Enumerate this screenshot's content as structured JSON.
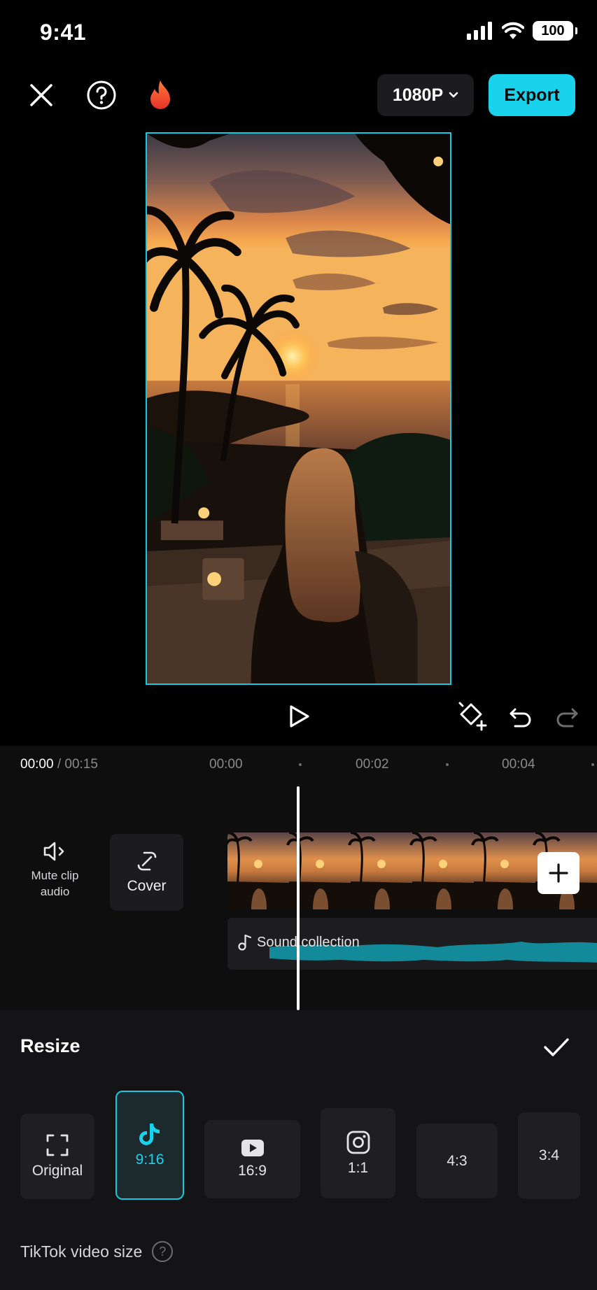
{
  "status_bar": {
    "time": "9:41",
    "battery": "100"
  },
  "toolbar": {
    "resolution": "1080P",
    "export_label": "Export"
  },
  "timeline": {
    "current_time": "00:00",
    "total_time": "/ 00:15",
    "ruler": [
      "00:00",
      "00:02",
      "00:04"
    ],
    "tools": {
      "mute_label": "Mute clip audio",
      "cover_label": "Cover"
    },
    "audio_track_label": "Sound collection"
  },
  "resize_panel": {
    "title": "Resize",
    "options": [
      {
        "label": "Original",
        "icon": "expand-frame-icon",
        "selected": false
      },
      {
        "label": "9:16",
        "icon": "tiktok-icon",
        "selected": true
      },
      {
        "label": "16:9",
        "icon": "youtube-icon",
        "selected": false
      },
      {
        "label": "1:1",
        "icon": "instagram-icon",
        "selected": false
      },
      {
        "label": "4:3",
        "icon": "",
        "selected": false
      },
      {
        "label": "3:4",
        "icon": "",
        "selected": false
      }
    ],
    "size_note": "TikTok video size"
  },
  "colors": {
    "accent": "#19d3ec",
    "background": "#000000",
    "panel": "#141416",
    "audio_wave": "#138a9a"
  }
}
